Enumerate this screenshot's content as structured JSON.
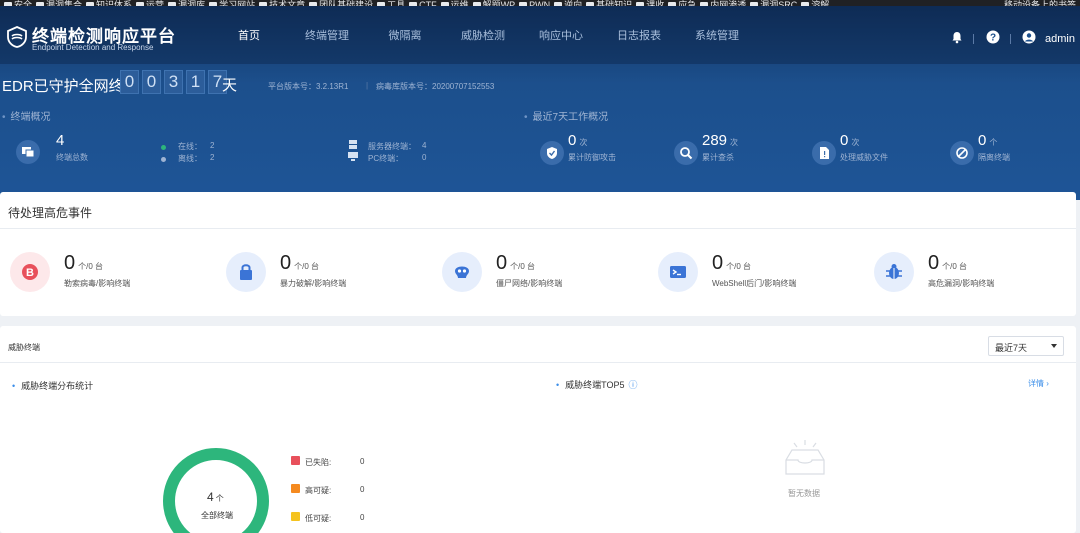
{
  "bookmarks": [
    {
      "label": "安全"
    },
    {
      "label": "漏洞集合"
    },
    {
      "label": "知识体系"
    },
    {
      "label": "运营"
    },
    {
      "label": "漏洞库"
    },
    {
      "label": "学习网站"
    },
    {
      "label": "技术文章"
    },
    {
      "label": "团队基础建设"
    },
    {
      "label": "工具"
    },
    {
      "label": "CTF"
    },
    {
      "label": "运维"
    },
    {
      "label": "解题WP"
    },
    {
      "label": "PWN"
    },
    {
      "label": "逆向"
    },
    {
      "label": "基础知识"
    },
    {
      "label": "课收"
    },
    {
      "label": "应急"
    },
    {
      "label": "内网渗透"
    },
    {
      "label": "漏洞SRC"
    },
    {
      "label": "溶解"
    }
  ],
  "bookmark_right": "移动设备上的书签",
  "brand": {
    "title": "终端检测响应平台",
    "subtitle": "Endpoint Detection and Response"
  },
  "nav": [
    {
      "label": "首页",
      "active": true
    },
    {
      "label": "终端管理"
    },
    {
      "label": "微隔离"
    },
    {
      "label": "威胁检测"
    },
    {
      "label": "响应中心"
    },
    {
      "label": "日志报表"
    },
    {
      "label": "系统管理"
    }
  ],
  "user": {
    "name": "admin"
  },
  "protect": {
    "label": "EDR已守护全网终端",
    "digits": [
      "0",
      "0",
      "3",
      "1",
      "7"
    ],
    "unit": "天",
    "platform_version": "平台版本号：3.2.13R1",
    "virus_db_version": "病毒库版本号：20200707152553"
  },
  "terminal_overview": {
    "title": "终端概况",
    "total": "4",
    "total_label": "终端总数",
    "online_label": "在线：",
    "online": "2",
    "offline_label": "离线：",
    "offline": "2",
    "server_label": "服务器终端：",
    "server": "4",
    "pc_label": "PC终端：",
    "pc": "0"
  },
  "work_overview": {
    "title": "最近7天工作概况",
    "items": [
      {
        "num": "0",
        "unit": "次",
        "label": "累计防御攻击",
        "icon": "shield-check-icon"
      },
      {
        "num": "289",
        "unit": "次",
        "label": "累计查杀",
        "icon": "scan-icon"
      },
      {
        "num": "0",
        "unit": "次",
        "label": "处理威胁文件",
        "icon": "file-alert-icon"
      },
      {
        "num": "0",
        "unit": "个",
        "label": "隔离终端",
        "icon": "isolate-icon"
      }
    ]
  },
  "pending": {
    "title": "待处理高危事件",
    "items": [
      {
        "num": "0",
        "unit": "个/0 台",
        "label": "勒索病毒/影响终端",
        "icon": "bitcoin-icon",
        "bg": "#fde8ea",
        "fg": "#e8505b"
      },
      {
        "num": "0",
        "unit": "个/0 台",
        "label": "暴力破解/影响终端",
        "icon": "lock-icon",
        "bg": "#e6eefc",
        "fg": "#3b74d6"
      },
      {
        "num": "0",
        "unit": "个/0 台",
        "label": "僵尸网络/影响终端",
        "icon": "skull-icon",
        "bg": "#e6eefc",
        "fg": "#3b74d6"
      },
      {
        "num": "0",
        "unit": "个/0 台",
        "label": "WebShell后门/影响终端",
        "icon": "terminal-icon",
        "bg": "#e6eefc",
        "fg": "#3b74d6"
      },
      {
        "num": "0",
        "unit": "个/0 台",
        "label": "高危漏洞/影响终端",
        "icon": "bug-icon",
        "bg": "#e6eefc",
        "fg": "#3b74d6"
      }
    ]
  },
  "threat": {
    "title": "威胁终端",
    "range": "最近7天",
    "dist_title": "威胁终端分布统计",
    "top_title": "威胁终端TOP5",
    "details": "详情 ›",
    "empty": "暂无数据",
    "donut_total": "4",
    "donut_unit": "个",
    "donut_label": "全部终端",
    "donut_color": "#2db67c",
    "legend": [
      {
        "label": "已失陷:",
        "value": "0",
        "color": "#e8505b"
      },
      {
        "label": "高可疑:",
        "value": "0",
        "color": "#f58a1f"
      },
      {
        "label": "低可疑:",
        "value": "0",
        "color": "#f5c31f"
      }
    ]
  }
}
